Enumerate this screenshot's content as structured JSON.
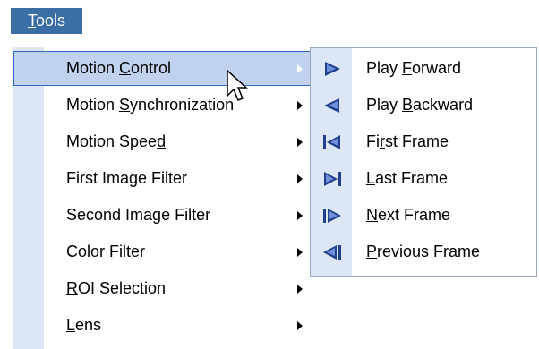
{
  "menubar": {
    "tools_label": "Tools",
    "tools_mnemonic": "T",
    "tools_rest": "ools"
  },
  "main_menu": {
    "items": [
      {
        "pre": "Motion ",
        "mn": "C",
        "post": "ontrol",
        "submenu": true,
        "selected": true
      },
      {
        "pre": "Motion ",
        "mn": "S",
        "post": "ynchronization",
        "submenu": true
      },
      {
        "pre": "Motion Spee",
        "mn": "d",
        "post": "",
        "submenu": true
      },
      {
        "pre": "First Image Filter",
        "mn": "",
        "post": "",
        "submenu": true
      },
      {
        "pre": "Second Image Filter",
        "mn": "",
        "post": "",
        "submenu": true
      },
      {
        "pre": "Color Filter",
        "mn": "",
        "post": "",
        "submenu": true
      },
      {
        "pre": "",
        "mn": "R",
        "post": "OI Selection",
        "submenu": true
      },
      {
        "pre": "",
        "mn": "L",
        "post": "ens",
        "submenu": true
      }
    ]
  },
  "sub_menu": {
    "items": [
      {
        "pre": "Play ",
        "mn": "F",
        "post": "orward",
        "icon": "play-forward-icon"
      },
      {
        "pre": "Play ",
        "mn": "B",
        "post": "ackward",
        "icon": "play-backward-icon"
      },
      {
        "pre": "Fi",
        "mn": "r",
        "post": "st Frame",
        "icon": "first-frame-icon"
      },
      {
        "pre": "",
        "mn": "L",
        "post": "ast Frame",
        "icon": "last-frame-icon"
      },
      {
        "pre": "",
        "mn": "N",
        "post": "ext Frame",
        "icon": "next-frame-icon"
      },
      {
        "pre": "",
        "mn": "P",
        "post": "revious Frame",
        "icon": "previous-frame-icon"
      }
    ]
  },
  "colors": {
    "accent": "#3a6ea5",
    "selection": "#c1d2ee",
    "gutter": "#dce6f4",
    "icon": "#1f3f8f"
  }
}
